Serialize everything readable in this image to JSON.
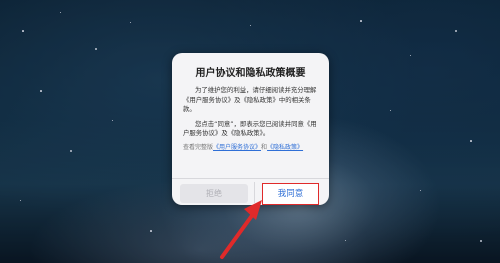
{
  "dialog": {
    "title": "用户协议和隐私政策概要",
    "paragraph1_lead": "为了维护您的利益，请仔细阅读并充分理解《用户服务协议》及《隐私政策》中的相关条款。",
    "paragraph2_lead": "您点击“同意”，即表示您已阅读并同意《用户服务协议》及《隐私政策》。",
    "view_prefix": "查看完整版",
    "link_user_agreement": "《用户服务协议》",
    "and_text": "和",
    "link_privacy_policy": "《隐私政策》",
    "reject_label": "拒绝",
    "agree_label": "我同意"
  },
  "colors": {
    "link": "#2f6fd6",
    "highlight_border": "#e02a2a",
    "arrow": "#e02a2a"
  }
}
